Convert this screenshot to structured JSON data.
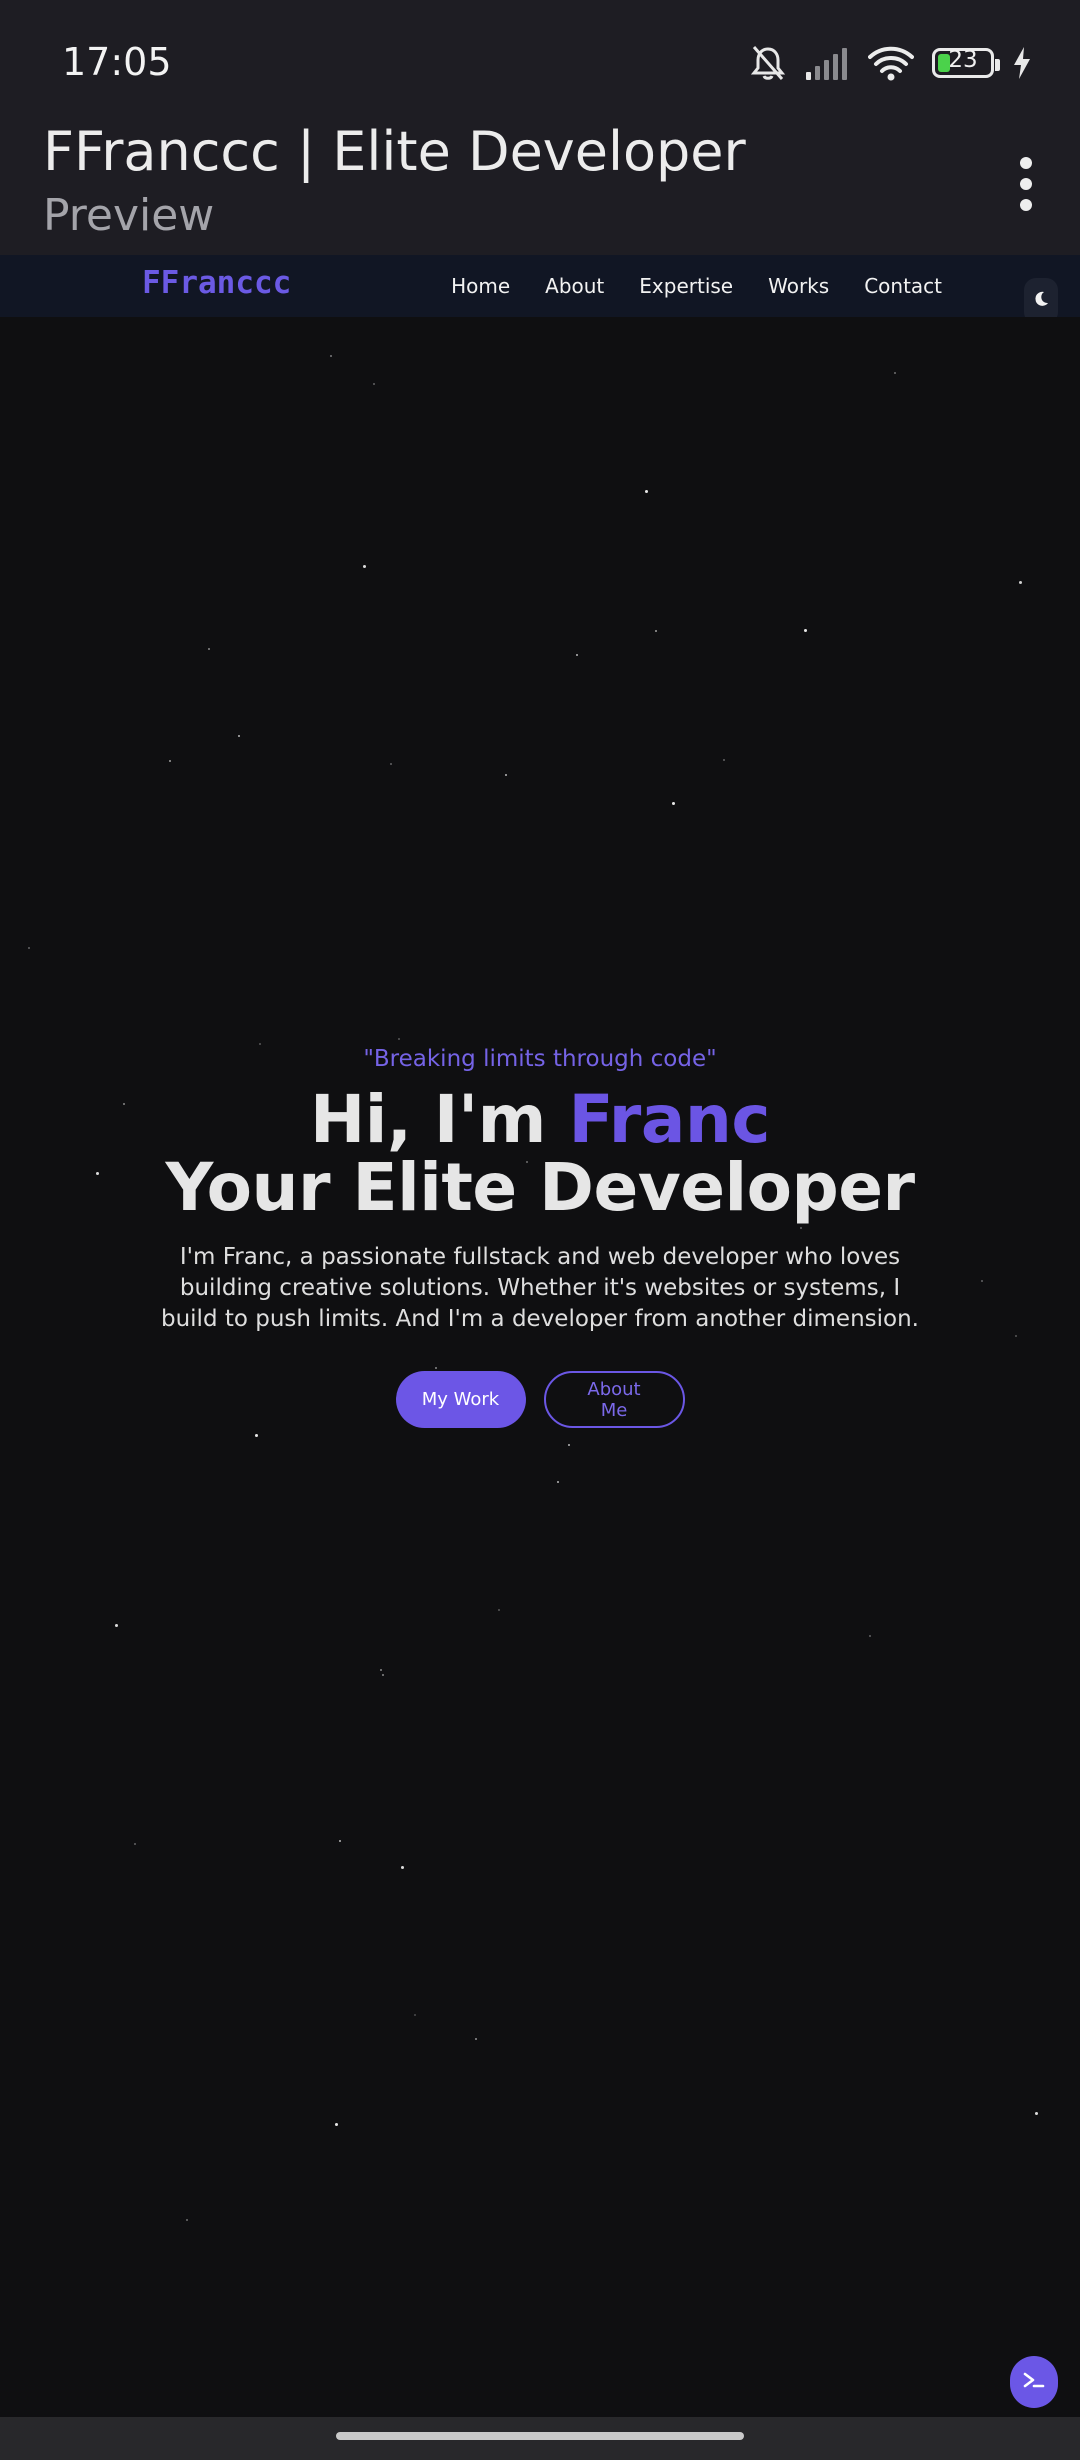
{
  "status_bar": {
    "time": "17:05",
    "battery_level": "23",
    "icons": [
      "bell-off-icon",
      "signal-icon",
      "wifi-icon",
      "battery-icon",
      "charging-bolt-icon"
    ]
  },
  "app_header": {
    "title": "FFranccc | Elite Developer",
    "subtitle": "Preview",
    "menu_icon": "more-vertical-icon"
  },
  "site_nav": {
    "brand": "FFranccc",
    "links": [
      "Home",
      "About",
      "Expertise",
      "Works",
      "Contact"
    ],
    "theme_icon": "moon-icon"
  },
  "hero": {
    "quote": "\"Breaking limits through code\"",
    "greeting": "Hi, I'm",
    "name": "Franc",
    "headline": "Your Elite Developer",
    "description": "I'm Franc, a passionate fullstack and web developer who loves building creative solutions. Whether it's websites or systems, I build to push limits. And I'm a developer from another dimension.",
    "primary_button": "My Work",
    "secondary_button": "About Me"
  },
  "colors": {
    "accent": "#6b55e4",
    "chrome_background": "#1e1d23",
    "page_background": "#0f0f11",
    "nav_background": "#111624"
  },
  "fab_icon": "terminal-icon"
}
